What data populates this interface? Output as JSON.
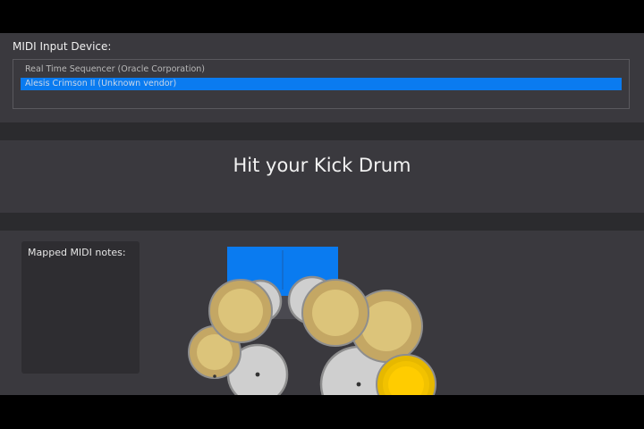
{
  "device": {
    "label": "MIDI Input Device:",
    "items": [
      {
        "label": "Real Time Sequencer (Oracle Corporation)",
        "selected": false
      },
      {
        "label": "Alesis Crimson II (Unknown vendor)",
        "selected": true
      }
    ]
  },
  "prompt": {
    "text": "Hit your Kick Drum"
  },
  "notes": {
    "label": "Mapped MIDI notes:"
  },
  "colors": {
    "accent": "#0a7bf0",
    "cymbal": "#dcc47a",
    "drum_head": "#cfcfcf",
    "highlight": "#ffcc00"
  },
  "drum_kit": {
    "active_piece": "kick-drum",
    "icons": [
      "bass-drum-icon",
      "snare-drum-icon",
      "tom-drum-icon",
      "cymbal-icon"
    ]
  }
}
